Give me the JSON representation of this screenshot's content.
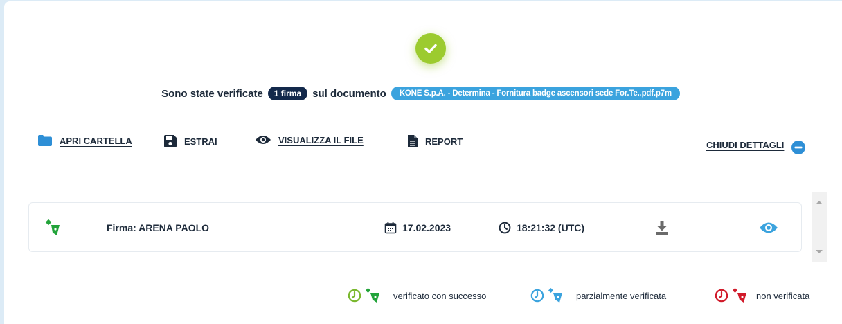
{
  "summary": {
    "prefix": "Sono state verificate",
    "count_badge": "1 firma",
    "middle": "sul documento",
    "document_name": "KONE S.p.A. - Determina - Fornitura badge ascensori sede For.Te..pdf.p7m"
  },
  "actions": {
    "open_folder": "APRI CARTELLA",
    "extract": "ESTRAI",
    "view_file": "VISUALIZZA IL FILE",
    "report": "REPORT",
    "close_details": "CHIUDI DETTAGLI"
  },
  "signatures": [
    {
      "label": "Firma: ARENA PAOLO",
      "date": "17.02.2023",
      "time": "18:21:32 (UTC)",
      "status": "verified"
    }
  ],
  "legend": {
    "success": "verificato con successo",
    "partial": "parzialmente verificata",
    "failed": "non verificata"
  },
  "colors": {
    "success": "#22a33a",
    "partial": "#3ba3de",
    "failed": "#d11a2a",
    "brand_dark": "#13294b",
    "check_badge": "#9ccb2f"
  },
  "icons": [
    "check-icon",
    "folder-icon",
    "save-icon",
    "eye-icon",
    "document-icon",
    "minus-circle-icon",
    "signature-pen-icon",
    "calendar-icon",
    "clock-icon",
    "download-icon"
  ]
}
